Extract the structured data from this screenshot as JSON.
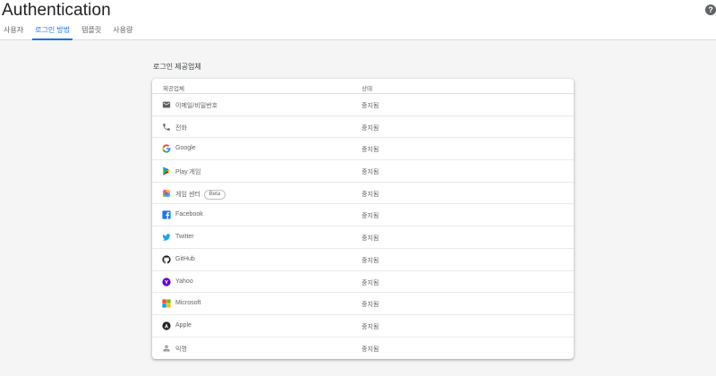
{
  "header": {
    "title": "Authentication",
    "help_icon": "help-circle-icon",
    "help_glyph": "?"
  },
  "tabs": [
    {
      "label": "사용자",
      "active": false
    },
    {
      "label": "로그인 방법",
      "active": true
    },
    {
      "label": "템플릿",
      "active": false
    },
    {
      "label": "사용량",
      "active": false
    }
  ],
  "section": {
    "title": "로그인 제공업체"
  },
  "table": {
    "col_provider": "제공업체",
    "col_status": "상태",
    "rows": [
      {
        "label": "이메일/비밀번호",
        "icon": "email-icon",
        "status": "중지됨",
        "badge": ""
      },
      {
        "label": "전화",
        "icon": "phone-icon",
        "status": "중지됨",
        "badge": ""
      },
      {
        "label": "Google",
        "icon": "google-icon",
        "status": "중지됨",
        "badge": ""
      },
      {
        "label": "Play 게임",
        "icon": "play-games-icon",
        "status": "중지됨",
        "badge": ""
      },
      {
        "label": "게임 센터",
        "icon": "game-center-icon",
        "status": "중지됨",
        "badge": "Beta"
      },
      {
        "label": "Facebook",
        "icon": "facebook-icon",
        "status": "중지됨",
        "badge": ""
      },
      {
        "label": "Twitter",
        "icon": "twitter-icon",
        "status": "중지됨",
        "badge": ""
      },
      {
        "label": "GitHub",
        "icon": "github-icon",
        "status": "중지됨",
        "badge": ""
      },
      {
        "label": "Yahoo",
        "icon": "yahoo-icon",
        "status": "중지됨",
        "badge": ""
      },
      {
        "label": "Microsoft",
        "icon": "microsoft-icon",
        "status": "중지됨",
        "badge": ""
      },
      {
        "label": "Apple",
        "icon": "apple-icon",
        "status": "중지됨",
        "badge": ""
      },
      {
        "label": "익명",
        "icon": "anonymous-user-icon",
        "status": "중지됨",
        "badge": ""
      }
    ]
  },
  "colors": {
    "accent": "#1a73e8",
    "background": "#f5f5f5",
    "card": "#ffffff",
    "text_secondary": "#5f6368"
  }
}
